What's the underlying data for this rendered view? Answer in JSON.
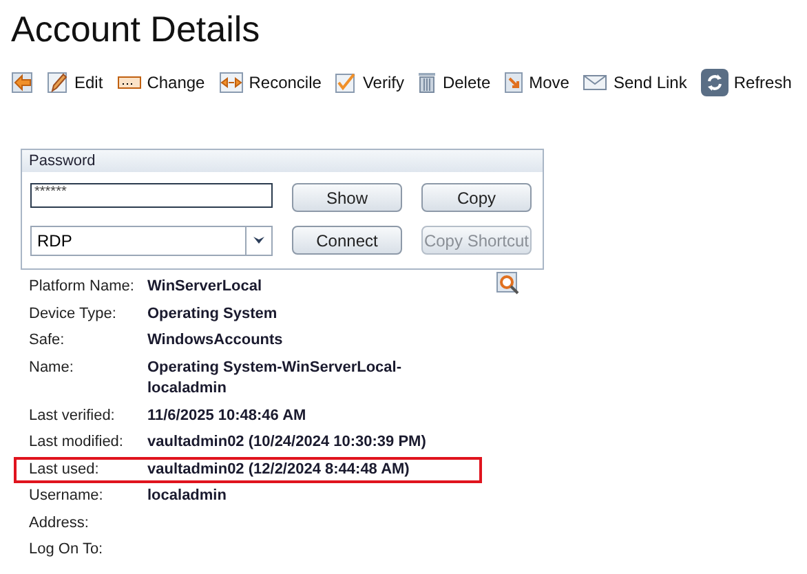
{
  "title": "Account Details",
  "toolbar": [
    {
      "kind": "back"
    },
    {
      "kind": "edit",
      "label": "Edit"
    },
    {
      "kind": "change",
      "label": "Change"
    },
    {
      "kind": "reconcile",
      "label": "Reconcile"
    },
    {
      "kind": "verify",
      "label": "Verify"
    },
    {
      "kind": "delete",
      "label": "Delete"
    },
    {
      "kind": "move",
      "label": "Move"
    },
    {
      "kind": "send-link",
      "label": "Send Link"
    },
    {
      "kind": "refresh",
      "label": "Refresh"
    }
  ],
  "password_panel": {
    "title": "Password",
    "password": "******",
    "connection": "RDP",
    "buttons": [
      {
        "label": "Show",
        "disabled": false
      },
      {
        "label": "Copy",
        "disabled": false
      },
      {
        "label": "Connect",
        "disabled": false
      },
      {
        "label": "Copy Shortcut",
        "disabled": true
      }
    ]
  },
  "details": [
    {
      "label": "Platform Name:",
      "value": "WinServerLocal",
      "highlighted": false
    },
    {
      "label": "Device Type:",
      "value": "Operating System",
      "highlighted": false
    },
    {
      "label": "Safe:",
      "value": "WindowsAccounts",
      "highlighted": false
    },
    {
      "label": "Name:",
      "value": "Operating System-WinServerLocal-localadmin",
      "highlighted": false
    },
    {
      "label": "Last verified:",
      "value": "11/6/2025 10:48:46 AM",
      "highlighted": false
    },
    {
      "label": "Last modified:",
      "value": "vaultadmin02 (10/24/2024 10:30:39 PM)",
      "highlighted": false
    },
    {
      "label": "Last used:",
      "value": "vaultadmin02 (12/2/2024 8:44:48 AM)",
      "highlighted": true
    },
    {
      "label": "Username:",
      "value": "localadmin",
      "highlighted": false
    },
    {
      "label": "Address:",
      "highlighted": false
    },
    {
      "label": "Log On To:",
      "highlighted": false
    }
  ]
}
